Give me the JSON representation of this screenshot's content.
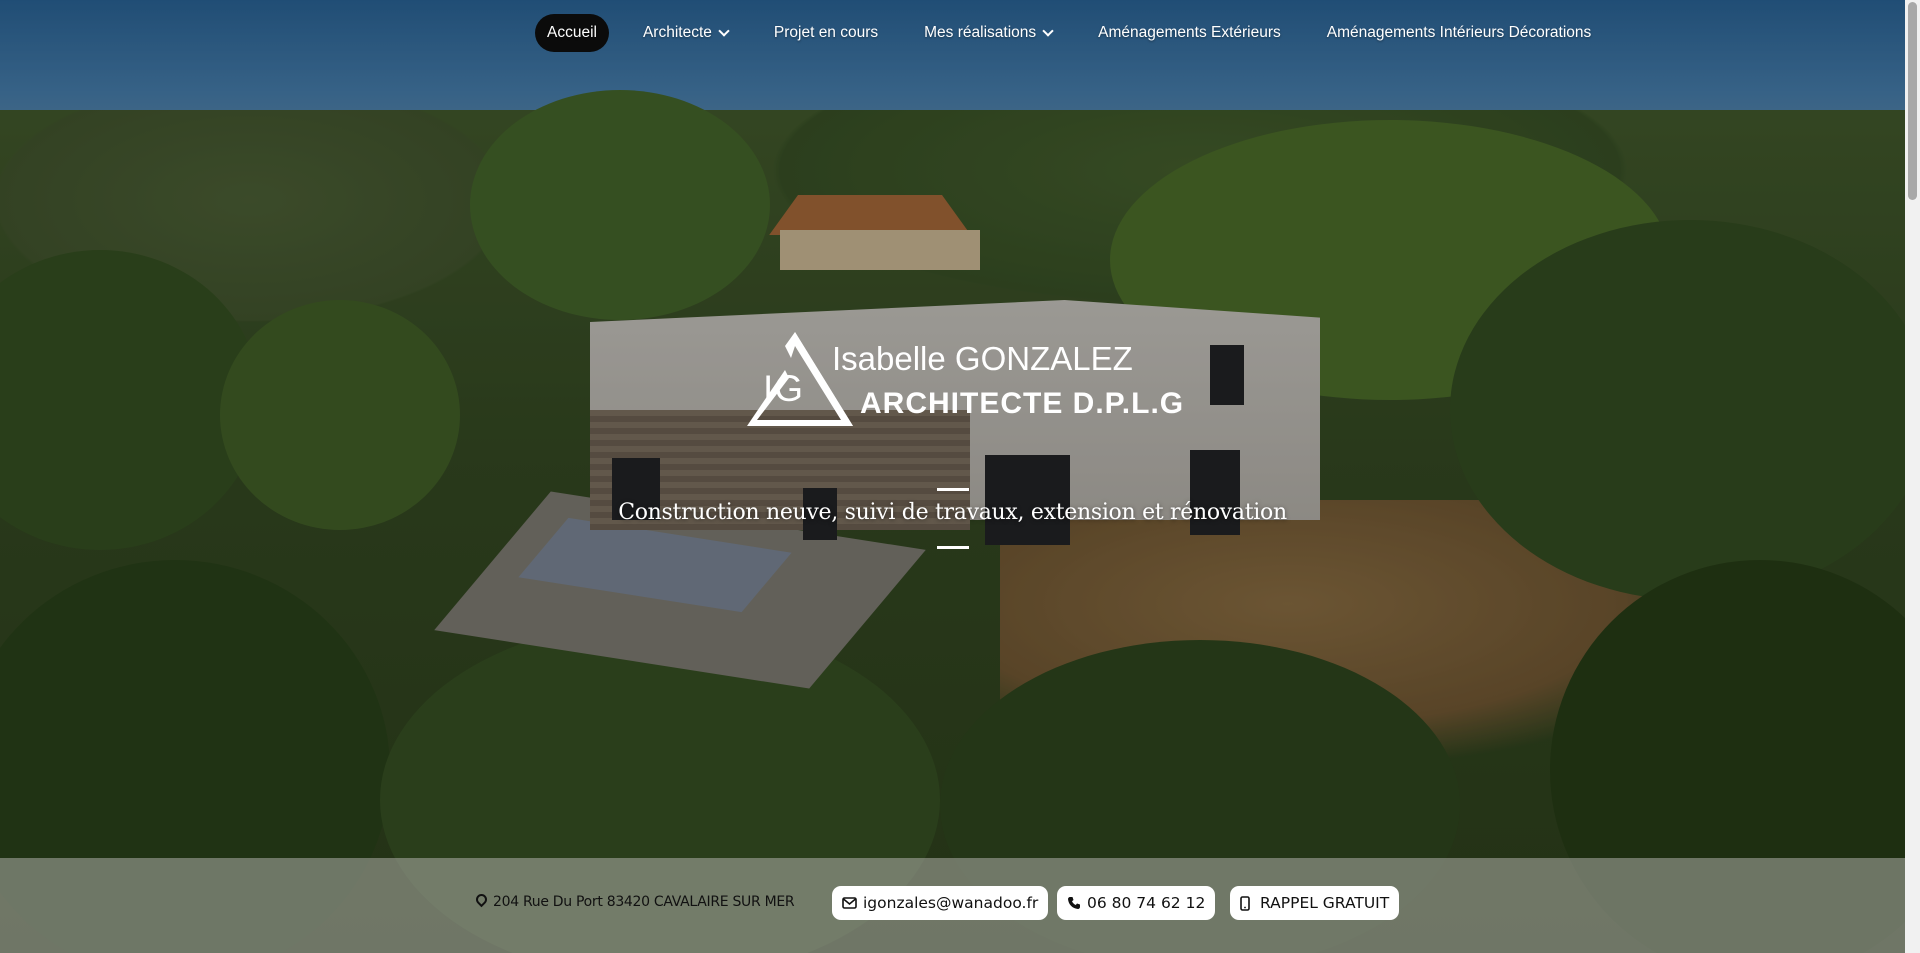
{
  "nav": {
    "items": [
      {
        "label": "Accueil",
        "active": true,
        "has_dropdown": false
      },
      {
        "label": "Architecte",
        "active": false,
        "has_dropdown": true
      },
      {
        "label": "Projet en cours",
        "active": false,
        "has_dropdown": false
      },
      {
        "label": "Mes réalisations",
        "active": false,
        "has_dropdown": true
      },
      {
        "label": "Aménagements Extérieurs",
        "active": false,
        "has_dropdown": false
      },
      {
        "label": "Aménagements Intérieurs Décorations",
        "active": false,
        "has_dropdown": false
      }
    ]
  },
  "logo": {
    "initials": "IG",
    "name": "Isabelle GONZALEZ",
    "title": "ARCHITECTE D.P.L.G"
  },
  "hero": {
    "tagline": "Construction neuve, suivi de travaux, extension et rénovation"
  },
  "contact": {
    "address": "204 Rue Du Port 83420 CAVALAIRE SUR MER",
    "email": "igonzales@wanadoo.fr",
    "phone": "06 80 74 62 12",
    "callback_label": "RAPPEL GRATUIT"
  },
  "icons": {
    "address": "map-pin-icon",
    "email": "envelope-icon",
    "phone": "phone-icon",
    "callback": "mobile-phone-icon",
    "dropdown": "chevron-down-icon"
  },
  "colors": {
    "nav_active_bg": "#0b0b0b",
    "contact_bar_bg": "rgba(175,175,170,0.55)",
    "pill_bg": "#ffffff"
  }
}
